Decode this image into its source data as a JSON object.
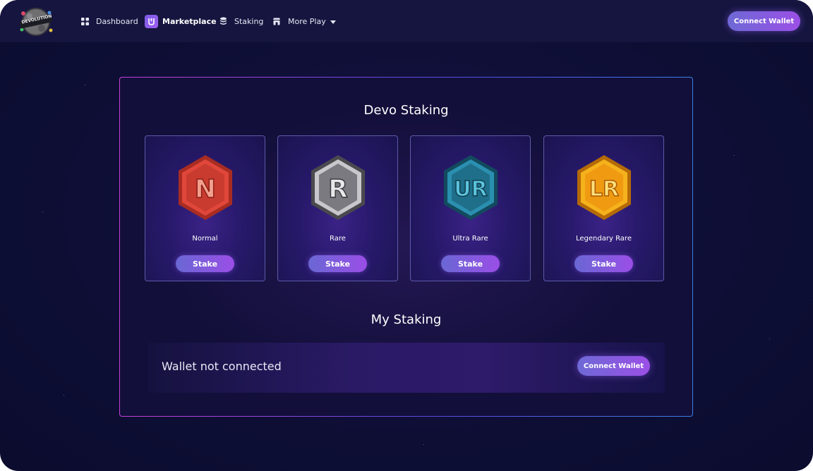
{
  "header": {
    "logo_text": "DEVOLUTION",
    "nav": [
      {
        "label": "Dashboard",
        "icon": "grid-icon"
      },
      {
        "label": "Marketplace",
        "icon": "bag-icon",
        "active": true
      },
      {
        "label": "Staking",
        "icon": "coin-stack-icon"
      },
      {
        "label": "More Play",
        "icon": "store-icon",
        "dropdown": true
      }
    ],
    "connect_label": "Connect Wallet"
  },
  "staking": {
    "title": "Devo Staking",
    "tiers": [
      {
        "badge": "N",
        "name": "Normal",
        "button": "Stake",
        "color": "#e0473a"
      },
      {
        "badge": "R",
        "name": "Rare",
        "button": "Stake",
        "color": "#9a9a9a"
      },
      {
        "badge": "UR",
        "name": "Ultra Rare",
        "button": "Stake",
        "color": "#2b8fb0"
      },
      {
        "badge": "LR",
        "name": "Legendary Rare",
        "button": "Stake",
        "color": "#f5b21c"
      }
    ]
  },
  "my_staking": {
    "title": "My Staking",
    "status": "Wallet not connected",
    "connect_label": "Connect Wallet"
  },
  "colors": {
    "accent_start": "#6e69d6",
    "accent_end": "#9b4fe6",
    "background": "#0b0c2e"
  }
}
